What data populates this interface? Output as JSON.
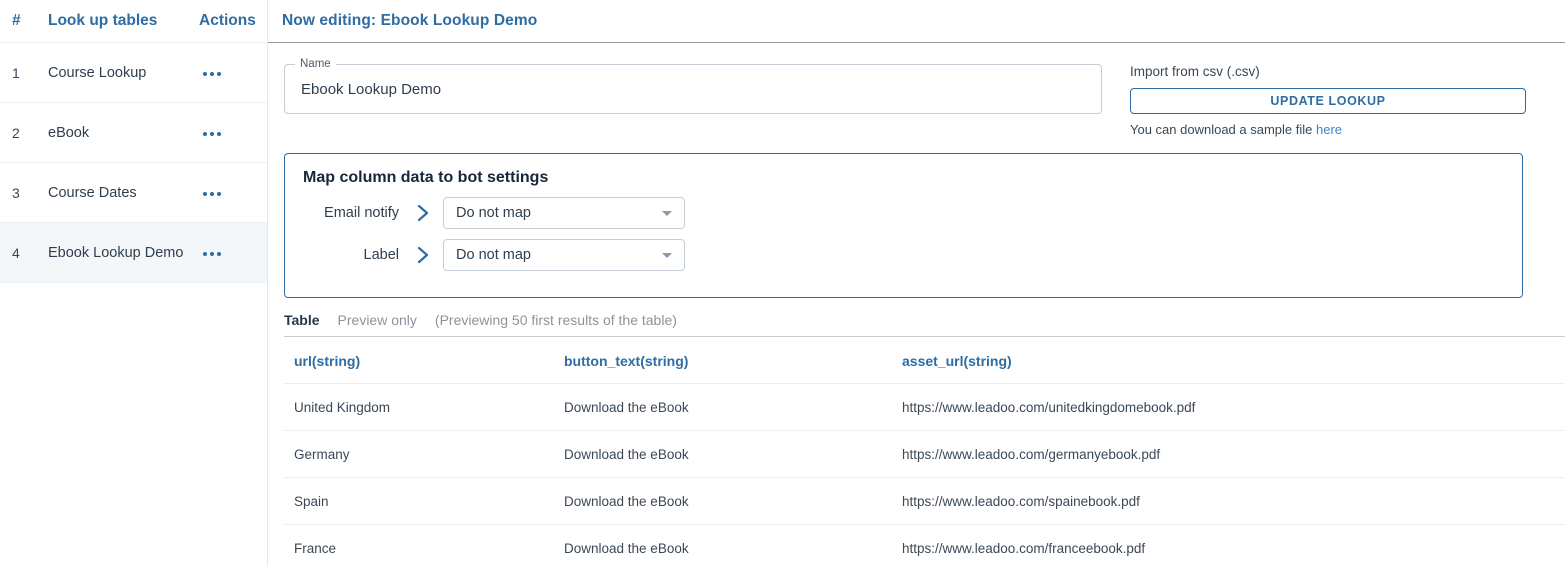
{
  "sidebar": {
    "columns": {
      "num": "#",
      "name": "Look up tables",
      "actions": "Actions"
    },
    "rows": [
      {
        "num": "1",
        "name": "Course Lookup",
        "actions_icon": "more-horizontal-icon"
      },
      {
        "num": "2",
        "name": "eBook",
        "actions_icon": "more-horizontal-icon"
      },
      {
        "num": "3",
        "name": "Course Dates",
        "actions_icon": "more-horizontal-icon"
      },
      {
        "num": "4",
        "name": "Ebook Lookup Demo",
        "actions_icon": "more-horizontal-icon"
      }
    ],
    "selected_index": 3
  },
  "main": {
    "header_title": "Now editing: Ebook Lookup Demo",
    "name_field": {
      "legend": "Name",
      "value": "Ebook Lookup Demo",
      "placeholder": "Name"
    },
    "import": {
      "label": "Import from csv (.csv)",
      "button_label": "UPDATE LOOKUP",
      "sample_prefix": "You can download a sample file ",
      "sample_link": "here"
    },
    "map_panel": {
      "title": "Map column data to bot settings",
      "rows": [
        {
          "label": "Email notify",
          "chevron_icon": "chevron-right-icon",
          "selected": "Do not map"
        },
        {
          "label": "Label",
          "chevron_icon": "chevron-right-icon",
          "selected": "Do not map"
        }
      ]
    },
    "table_meta": {
      "title": "Table",
      "mode": "Preview only",
      "note": "(Previewing 50 first results of the table)"
    },
    "table": {
      "columns": [
        "url(string)",
        "button_text(string)",
        "asset_url(string)"
      ],
      "rows": [
        [
          "United Kingdom",
          "Download the eBook",
          "https://www.leadoo.com/unitedkingdomebook.pdf"
        ],
        [
          "Germany",
          "Download the eBook",
          "https://www.leadoo.com/germanyebook.pdf"
        ],
        [
          "Spain",
          "Download the eBook",
          "https://www.leadoo.com/spainebook.pdf"
        ],
        [
          "France",
          "Download the eBook",
          "https://www.leadoo.com/franceebook.pdf"
        ]
      ]
    }
  },
  "colors": {
    "accent_blue": "#2e6ca3",
    "link_blue": "#3b86c4",
    "text_dark": "#2f3e4e",
    "text_muted": "#8b949d",
    "selected_row_bg": "#f4f7fa",
    "border_light": "#eceef0"
  }
}
